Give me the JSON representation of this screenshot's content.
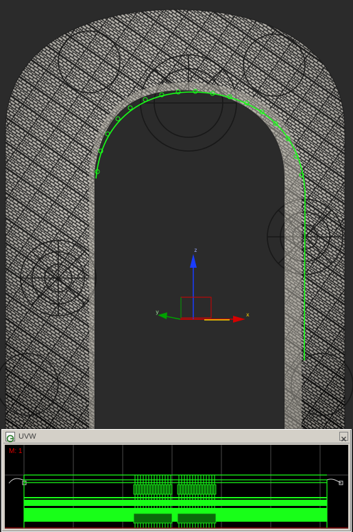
{
  "viewport": {
    "axis_x_label": "x",
    "axis_y_label": "y",
    "axis_z_label": "z",
    "colors": {
      "background": "#2b2b2b",
      "selection": "#18ff18",
      "axis_x": "#d40000",
      "axis_y": "#00a000",
      "axis_z": "#1a3cff",
      "axis_highlight": "#ffd400"
    }
  },
  "uvw_window": {
    "title": "UVW",
    "motion_label": "M: 1",
    "app_icon": "gear-g-icon",
    "close_icon": "close-icon"
  }
}
